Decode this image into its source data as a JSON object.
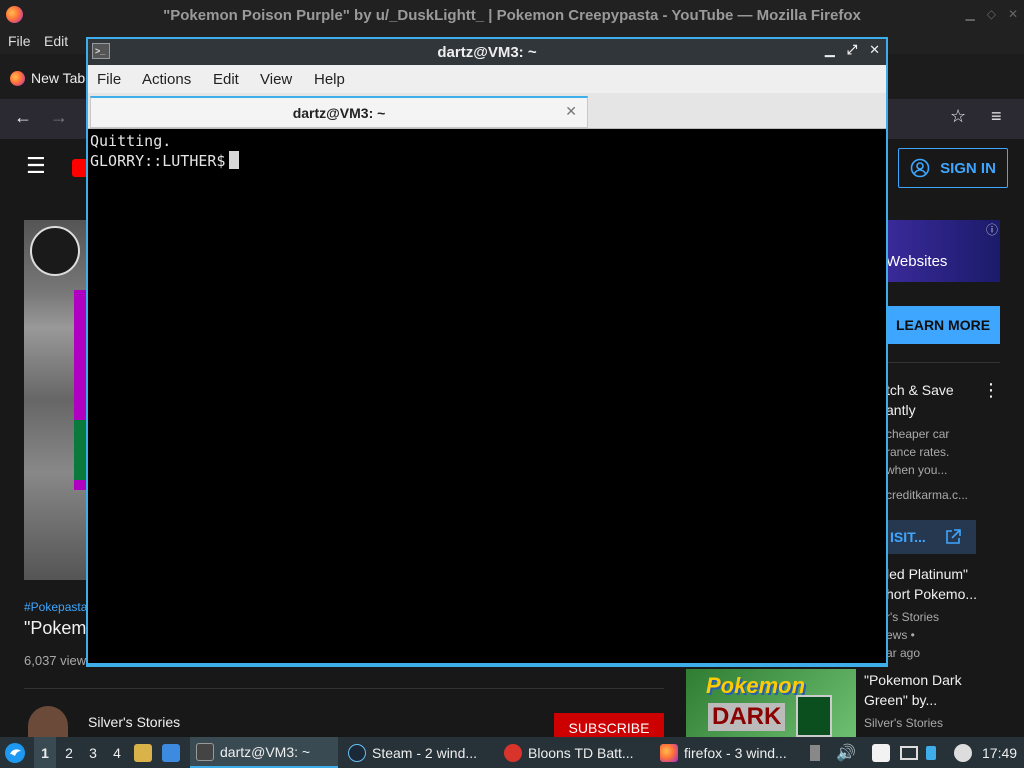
{
  "firefox": {
    "window_title": "\"Pokemon Poison Purple\" by u/_DuskLightt_ | Pokemon Creepypasta - YouTube — Mozilla Firefox",
    "menu": [
      "File",
      "Edit"
    ],
    "tab_label": "New Tab"
  },
  "youtube": {
    "sign_in": "SIGN IN",
    "ad_banner_text": "Websites",
    "learn_more": "LEARN MORE",
    "ad_card_title": "tch & Save\nantly",
    "ad_card_desc": "cheaper car\nrance rates.\nwhen you...",
    "ad_card_domain": "creditkarma.c...",
    "visit_label": "ISIT...",
    "hashtag": "#Pokepasta",
    "video_title_partial": "\"Pokem",
    "view_count_partial": "6,037 view",
    "channel_name": "Silver's Stories",
    "subscribe": "SUBSCRIBE",
    "rec1_title": "led Platinum\"\nhort Pokemo...",
    "rec1_channel": "r's Stories",
    "rec1_views": "ews •",
    "rec1_age": "ar ago",
    "rec2_title": "\"Pokemon Dark\nGreen\" by...",
    "rec2_channel": "Silver's Stories",
    "rec2_thumb_top": "Pokemon",
    "rec2_thumb_bottom": "DARK"
  },
  "terminal": {
    "title": "dartz@VM3: ~",
    "menu": [
      "File",
      "Actions",
      "Edit",
      "View",
      "Help"
    ],
    "tab_title": "dartz@VM3: ~",
    "lines": [
      "Quitting.",
      "GLORRY::LUTHER$"
    ]
  },
  "taskbar": {
    "workspaces": [
      "1",
      "2",
      "3",
      "4"
    ],
    "tasks": [
      "dartz@VM3: ~",
      "Steam - 2 wind...",
      "Bloons TD Batt...",
      "firefox - 3 wind..."
    ],
    "clock": "17:49"
  },
  "colors": {
    "accent": "#3daee9",
    "youtube_blue": "#3ea6ff",
    "subscribe_red": "#cc0000"
  }
}
